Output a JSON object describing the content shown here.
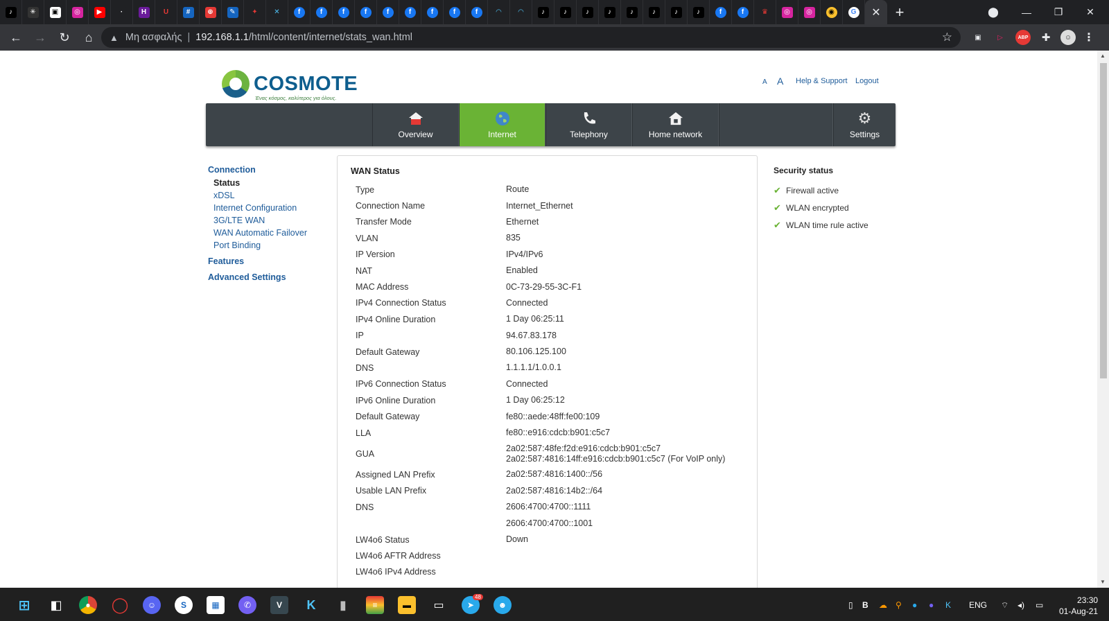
{
  "browser": {
    "url_warning": "Μη ασφαλής",
    "url_host": "192.168.1.1",
    "url_path": "/html/content/internet/stats_wan.html",
    "active_tab_close": "✕",
    "new_tab": "+"
  },
  "header": {
    "brand": "COSMOTE",
    "tagline": "Ένας κόσμος, καλύτερος για όλους.",
    "font_small": "A",
    "font_large": "A",
    "help": "Help & Support",
    "logout": "Logout"
  },
  "mainnav": [
    {
      "label": "Overview",
      "icon": "house-icon"
    },
    {
      "label": "Internet",
      "icon": "globe-icon"
    },
    {
      "label": "Telephony",
      "icon": "phone-icon"
    },
    {
      "label": "Home network",
      "icon": "home-network-icon"
    },
    {
      "label": "Settings",
      "icon": "gear-icon"
    }
  ],
  "sidenav": {
    "connection": "Connection",
    "items": [
      "Status",
      "xDSL",
      "Internet Configuration",
      "3G/LTE WAN",
      "WAN Automatic Failover",
      "Port Binding"
    ],
    "features": "Features",
    "advanced": "Advanced Settings"
  },
  "wan": {
    "title": "WAN Status",
    "rows": [
      {
        "label": "Type",
        "value": "Route"
      },
      {
        "label": "Connection Name",
        "value": "Internet_Ethernet"
      },
      {
        "label": "Transfer Mode",
        "value": "Ethernet"
      },
      {
        "label": "VLAN",
        "value": "835"
      },
      {
        "label": "IP Version",
        "value": "IPv4/IPv6"
      },
      {
        "label": "NAT",
        "value": "Enabled"
      },
      {
        "label": "MAC Address",
        "value": "0C-73-29-55-3C-F1"
      },
      {
        "label": "IPv4 Connection Status",
        "value": "Connected"
      },
      {
        "label": "IPv4 Online Duration",
        "value": "1 Day 06:25:11"
      },
      {
        "label": "IP",
        "value": "94.67.83.178"
      },
      {
        "label": "Default Gateway",
        "value": "80.106.125.100"
      },
      {
        "label": "DNS",
        "value": "1.1.1.1/1.0.0.1"
      },
      {
        "label": "IPv6 Connection Status",
        "value": "Connected"
      },
      {
        "label": "IPv6 Online Duration",
        "value": "1 Day 06:25:12"
      },
      {
        "label": "Default Gateway",
        "value": "fe80::aede:48ff:fe00:109"
      },
      {
        "label": "LLA",
        "value": "fe80::e916:cdcb:b901:c5c7"
      },
      {
        "label": "GUA",
        "value": "2a02:587:48fe:f2d:e916:cdcb:b901:c5c7",
        "value2": "2a02:587:4816:14ff:e916:cdcb:b901:c5c7 (For VoIP only)"
      },
      {
        "label": "Assigned LAN Prefix",
        "value": "2a02:587:4816:1400::/56"
      },
      {
        "label": "Usable LAN Prefix",
        "value": "2a02:587:4816:14b2::/64"
      },
      {
        "label": "DNS",
        "value": "2606:4700:4700::1111"
      },
      {
        "label": "",
        "value": "2606:4700:4700::1001"
      },
      {
        "label": "LW4o6 Status",
        "value": "Down"
      },
      {
        "label": "LW4o6 AFTR Address",
        "value": ""
      },
      {
        "label": "LW4o6 IPv4 Address",
        "value": ""
      }
    ]
  },
  "security": {
    "title": "Security status",
    "items": [
      "Firewall active",
      "WLAN encrypted",
      "WLAN time rule active"
    ]
  },
  "taskbar": {
    "lang": "ENG",
    "time": "23:30",
    "date": "01-Aug-21",
    "telegram_badge": "48"
  }
}
